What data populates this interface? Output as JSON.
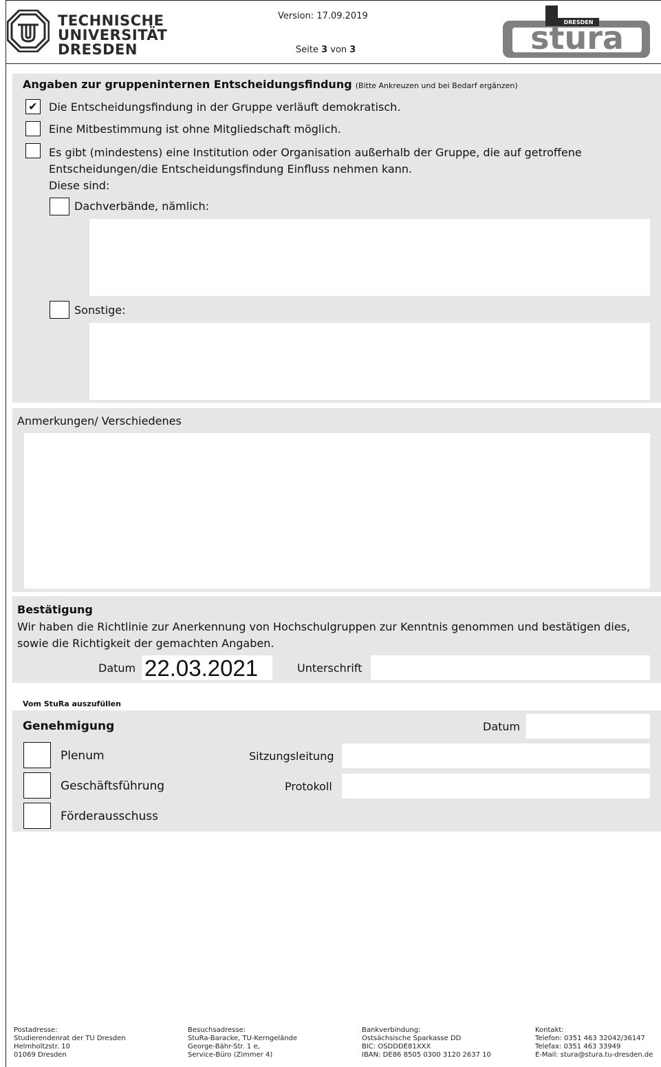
{
  "header": {
    "tu_logo_lines": [
      "TECHNISCHE",
      "UNIVERSITÄT",
      "DRESDEN"
    ],
    "version": "Version: 17.09.2019",
    "page_label_prefix": "Seite ",
    "page_current": "3",
    "page_of": " von ",
    "page_total": "3",
    "stura_logo_text": "stura",
    "stura_logo_sub": "DRESDEN"
  },
  "decision": {
    "title": "Angaben zur gruppeninternen Entscheidungsfindung",
    "hint": "(Bitte Ankreuzen und bei Bedarf ergänzen)",
    "options": [
      {
        "label": "Die Entscheidungsfindung in der Gruppe verläuft demokratisch.",
        "checked": true,
        "mark": "✔"
      },
      {
        "label": "Eine Mitbestimmung ist ohne Mitgliedschaft möglich.",
        "checked": false,
        "mark": ""
      },
      {
        "label_line1": "Es gibt (mindestens) eine Institution oder Organisation außerhalb der Gruppe, die auf getroffene",
        "label_line2": "Entscheidungen/die Entscheidungsfindung Einfluss nehmen kann.",
        "label_line3": "Diese sind:",
        "checked": false
      }
    ],
    "sub_options": [
      {
        "label": "Dachverbände, nämlich:",
        "checked": false,
        "value": ""
      },
      {
        "label": "Sonstige:",
        "checked": false,
        "value": ""
      }
    ]
  },
  "notes": {
    "title": "Anmerkungen/ Verschiedenes",
    "value": ""
  },
  "confirmation": {
    "title": "Bestätigung",
    "text_line1": "Wir haben die Richtlinie zur Anerkennung von Hochschulgruppen zur Kenntnis genommen und bestätigen dies,",
    "text_line2": "sowie die Richtigkeit der gemachten Angaben.",
    "date_label": "Datum",
    "date_value": "22.03.2021",
    "signature_label": "Unterschrift",
    "signature_value": ""
  },
  "stura_section": {
    "caption": "Vom StuRa auszufüllen",
    "title": "Genehmigung",
    "date_label": "Datum",
    "date_value": "",
    "options": [
      "Plenum",
      "Geschäftsführung",
      "Förderausschuss"
    ],
    "meeting_lead_label": "Sitzungsleitung",
    "minutes_label": "Protokoll"
  },
  "footer": {
    "postal": [
      "Postadresse:",
      "Studierendenrat der TU Dresden",
      "Helmholtzstr. 10",
      "01069 Dresden"
    ],
    "visit": [
      "Besuchsadresse:",
      "StuRa-Baracke, TU-Kerngelände",
      "George-Bähr-Str. 1 e,",
      "Service-Büro (Zimmer 4)"
    ],
    "bank": [
      "Bankverbindung:",
      "Ostsächsische Sparkasse DD",
      "BIC: OSDDDE81XXX",
      "IBAN: DE86 8505 0300 3120 2637 10"
    ],
    "contact": [
      "Kontakt:",
      "Telefon: 0351 463 32042/36147",
      "Telefax: 0351 463 33949",
      "E-Mail: stura@stura.tu-dresden.de"
    ]
  }
}
